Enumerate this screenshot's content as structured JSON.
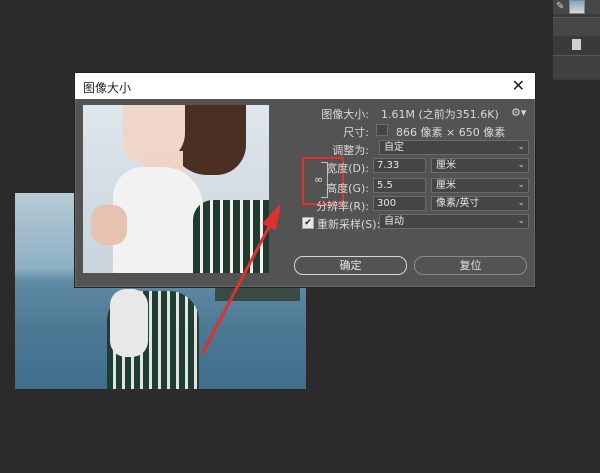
{
  "dialog": {
    "title": "图像大小",
    "close_symbol": "✕",
    "image_size_label": "图像大小:",
    "image_size_value": "1.61M (之前为351.6K)",
    "dimensions_label": "尺寸:",
    "dimensions_value": "866 像素 × 650 像素",
    "fit_to_label": "调整为:",
    "fit_to_value": "自定",
    "width_label": "宽度(D):",
    "width_value": "7.33",
    "width_unit": "厘米",
    "height_label": "高度(G):",
    "height_value": "5.5",
    "height_unit": "厘米",
    "resolution_label": "分辨率(R):",
    "resolution_value": "300",
    "resolution_unit": "像素/英寸",
    "resample_label": "重新采样(S):",
    "resample_value": "自动",
    "resample_checked": true,
    "ok_label": "确定",
    "reset_label": "复位"
  },
  "icons": {
    "gear": "gear-icon",
    "chain_link": "chain-link-icon",
    "chevron": "chevron-down-icon",
    "brush": "brush-icon",
    "document": "document-icon"
  },
  "colors": {
    "background": "#2b2b2b",
    "dialog": "#535353",
    "highlight_red": "#e03030"
  }
}
